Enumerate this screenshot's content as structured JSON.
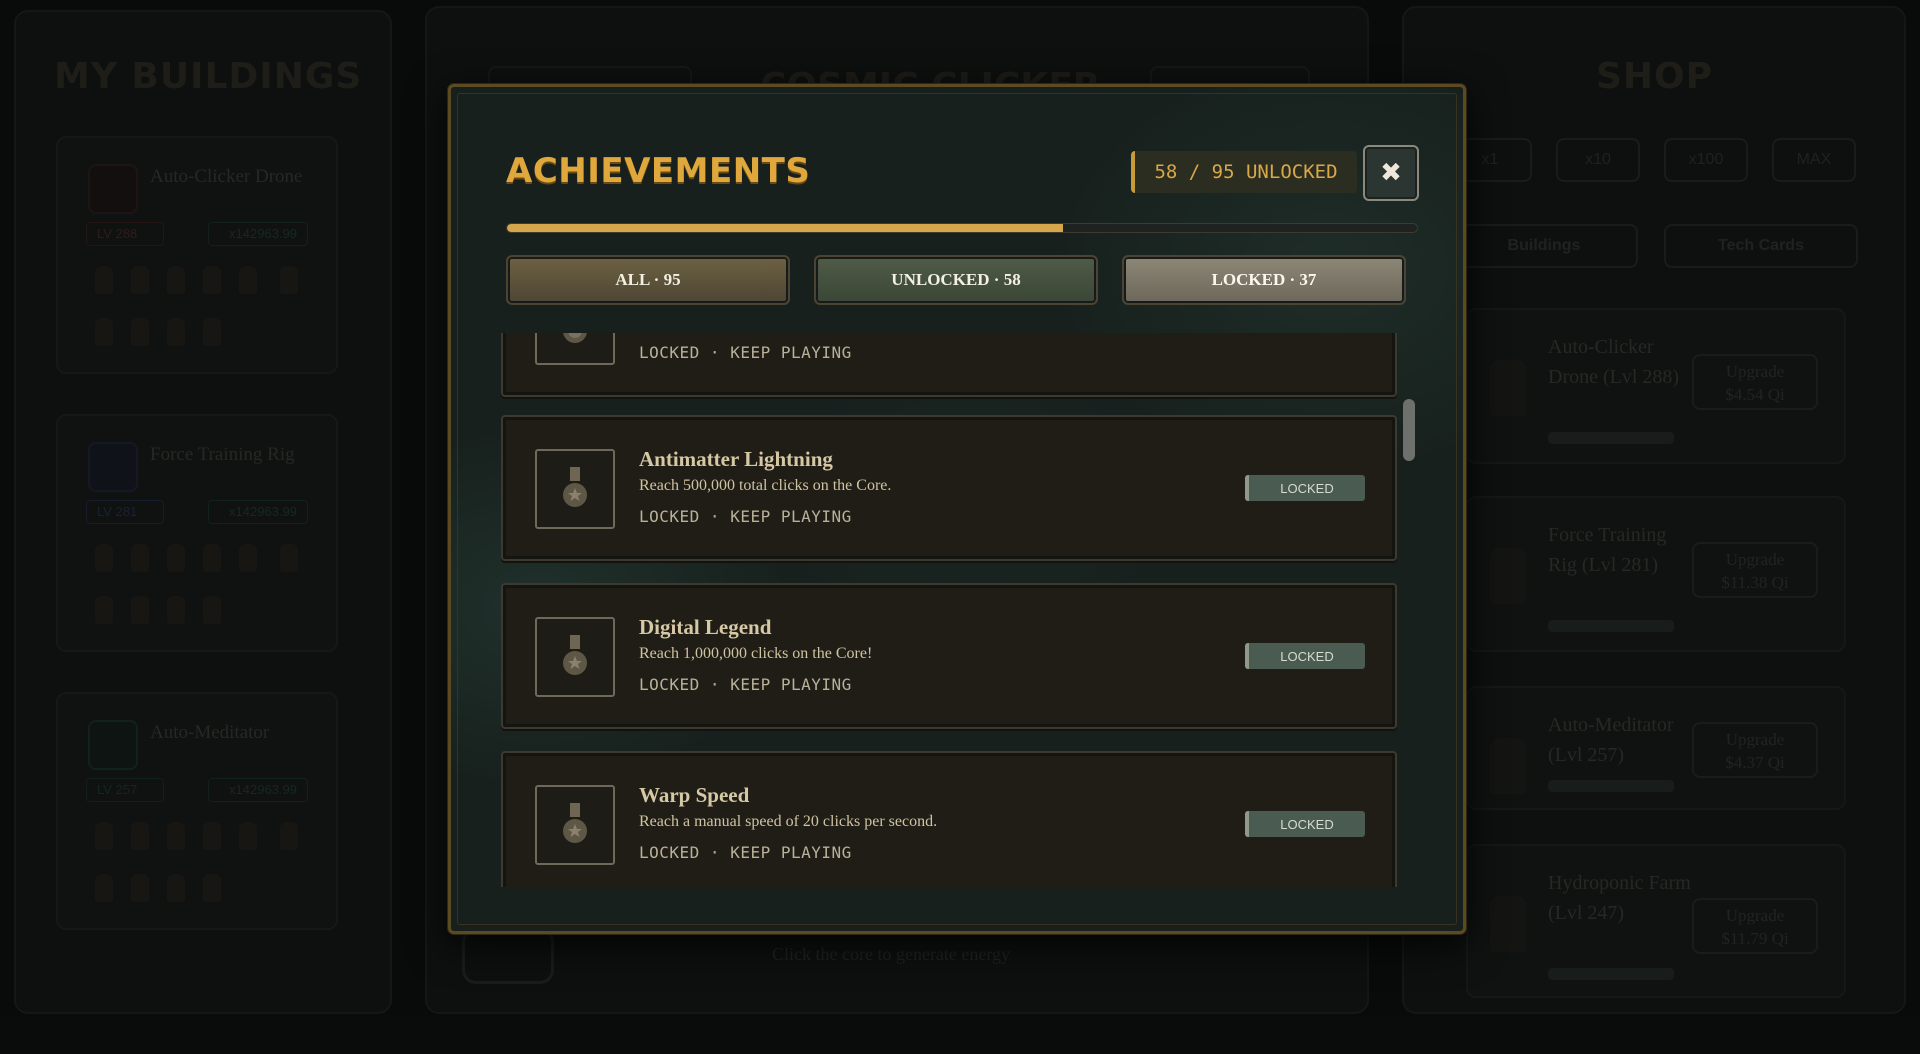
{
  "background": {
    "left_title": "MY BUILDINGS",
    "center_title": "COSMIC CLICKER",
    "right_title": "SHOP",
    "center_hint": "Click the core to generate energy",
    "buildings": [
      {
        "name": "Auto-Clicker Drone",
        "level": "LV 288",
        "mult": "x142963.99"
      },
      {
        "name": "Force Training Rig",
        "level": "LV 281",
        "mult": "x142963.99"
      },
      {
        "name": "Auto-Meditator",
        "level": "LV 257",
        "mult": "x142963.99"
      }
    ],
    "multipliers": [
      "x1",
      "x10",
      "x100",
      "MAX"
    ],
    "shop_tabs": [
      "Buildings",
      "Tech Cards"
    ],
    "shop_items": [
      {
        "name": "Auto-Clicker Drone (Lvl 288)",
        "upgrade": "Upgrade",
        "price": "$4.54 Qi"
      },
      {
        "name": "Force Training Rig (Lvl 281)",
        "upgrade": "Upgrade",
        "price": "$11.38 Qi"
      },
      {
        "name": "Auto-Meditator (Lvl 257)",
        "upgrade": "Upgrade",
        "price": "$4.37 Qi"
      },
      {
        "name": "Hydroponic Farm (Lvl 247)",
        "upgrade": "Upgrade",
        "price": "$11.79 Qi"
      }
    ]
  },
  "modal": {
    "title": "ACHIEVEMENTS",
    "unlocked_count_label": "58 / 95 UNLOCKED",
    "unlocked": 58,
    "total": 95,
    "progress_fraction": 0.6105,
    "close_icon": "close-icon",
    "filters": [
      {
        "label": "ALL · 95"
      },
      {
        "label": "UNLOCKED · 58"
      },
      {
        "label": "LOCKED · 37"
      }
    ],
    "achievements": [
      {
        "name": "",
        "desc": "",
        "status": "LOCKED · KEEP PLAYING",
        "badge": ""
      },
      {
        "name": "Antimatter Lightning",
        "desc": "Reach 500,000 total clicks on the Core.",
        "status": "LOCKED · KEEP PLAYING",
        "badge": "LOCKED"
      },
      {
        "name": "Digital Legend",
        "desc": "Reach 1,000,000 clicks on the Core!",
        "status": "LOCKED · KEEP PLAYING",
        "badge": "LOCKED"
      },
      {
        "name": "Warp Speed",
        "desc": "Reach a manual speed of 20 clicks per second.",
        "status": "LOCKED · KEEP PLAYING",
        "badge": "LOCKED"
      }
    ]
  },
  "colors": {
    "accent_gold": "#d6a64c",
    "modal_bg": "#17201d",
    "locked_badge": "#4a5b52"
  }
}
